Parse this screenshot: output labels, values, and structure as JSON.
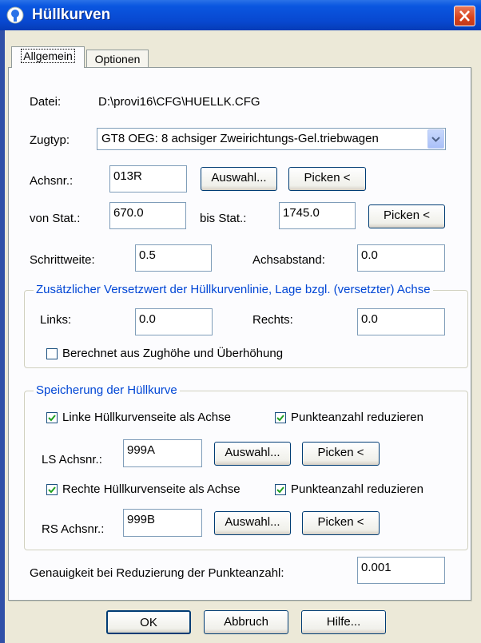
{
  "window": {
    "title": "Hüllkurven"
  },
  "tabs": [
    {
      "label": "Allgemein",
      "active": true
    },
    {
      "label": "Optionen",
      "active": false
    }
  ],
  "datei": {
    "label": "Datei:",
    "value": "D:\\provi16\\CFG\\HUELLK.CFG"
  },
  "zugtyp": {
    "label": "Zugtyp:",
    "value": "GT8 OEG: 8 achsiger Zweirichtungs-Gel.triebwagen"
  },
  "achsnr": {
    "label": "Achsnr.:",
    "value": "013R",
    "auswahl": "Auswahl...",
    "picken": "Picken <"
  },
  "station": {
    "von_label": "von Stat.:",
    "von_value": "670.0",
    "bis_label": "bis Stat.:",
    "bis_value": "1745.0",
    "picken": "Picken <"
  },
  "schrittweite": {
    "label": "Schrittweite:",
    "value": "0.5"
  },
  "achsabstand": {
    "label": "Achsabstand:",
    "value": "0.0"
  },
  "versatz_group": {
    "title": "Zusätzlicher Versetzwert der Hüllkurvenlinie, Lage bzgl. (versetzter) Achse",
    "links_label": "Links:",
    "links_value": "0.0",
    "rechts_label": "Rechts:",
    "rechts_value": "0.0",
    "berechnet_label": "Berechnet aus Zughöhe und Überhöhung",
    "berechnet_checked": false
  },
  "speicherung_group": {
    "title": "Speicherung der Hüllkurve",
    "linke_label": "Linke Hüllkurvenseite als Achse",
    "linke_checked": true,
    "punkte1_label": "Punkteanzahl reduzieren",
    "punkte1_checked": true,
    "ls_label": "LS Achsnr.:",
    "ls_value": "999A",
    "ls_auswahl": "Auswahl...",
    "ls_picken": "Picken <",
    "rechte_label": "Rechte Hüllkurvenseite als Achse",
    "rechte_checked": true,
    "punkte2_label": "Punkteanzahl reduzieren",
    "punkte2_checked": true,
    "rs_label": "RS Achsnr.:",
    "rs_value": "999B",
    "rs_auswahl": "Auswahl...",
    "rs_picken": "Picken <"
  },
  "genauigkeit": {
    "label": "Genauigkeit bei Reduzierung der Punkteanzahl:",
    "value": "0.001"
  },
  "buttons": {
    "ok": "OK",
    "abbruch": "Abbruch",
    "hilfe": "Hilfe..."
  },
  "colors": {
    "titlebar": "#0a56e0",
    "group_title": "#0046d5",
    "close": "#d8421b"
  }
}
